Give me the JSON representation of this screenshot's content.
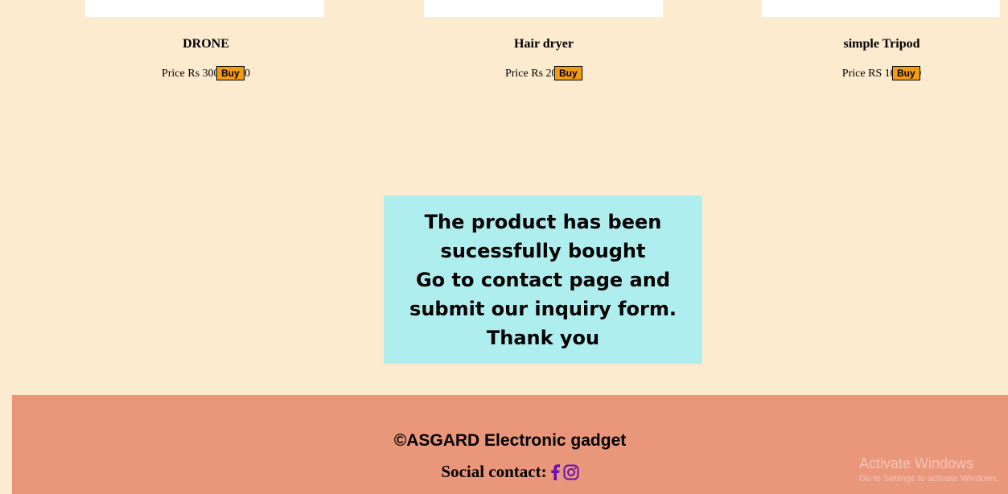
{
  "products": [
    {
      "name": "DRONE",
      "price": "Price Rs 300000.00",
      "buy_label": "Buy"
    },
    {
      "name": "Hair dryer",
      "price": "Price Rs 2000.00",
      "buy_label": "Buy"
    },
    {
      "name": "simple Tripod",
      "price": "Price RS 1000.00",
      "buy_label": "Buy"
    }
  ],
  "message": {
    "line1": "The product has been",
    "line2": "sucessfully bought",
    "line3": "Go to contact page and",
    "line4": "submit our inquiry form.",
    "line5": "Thank you"
  },
  "footer": {
    "copyright": "©ASGARD Electronic gadget",
    "social_label": "Social contact:",
    "icons": [
      "facebook-icon",
      "instagram-icon"
    ]
  },
  "watermark": {
    "title": "Activate Windows",
    "subtitle": "Go to Settings to activate Windows."
  },
  "colors": {
    "page_bg": "#fdebd0",
    "buy_button": "#f39c12",
    "message_bg": "#afeeee",
    "footer_bg": "#e9967a",
    "social_icon": "#6a0dad"
  }
}
